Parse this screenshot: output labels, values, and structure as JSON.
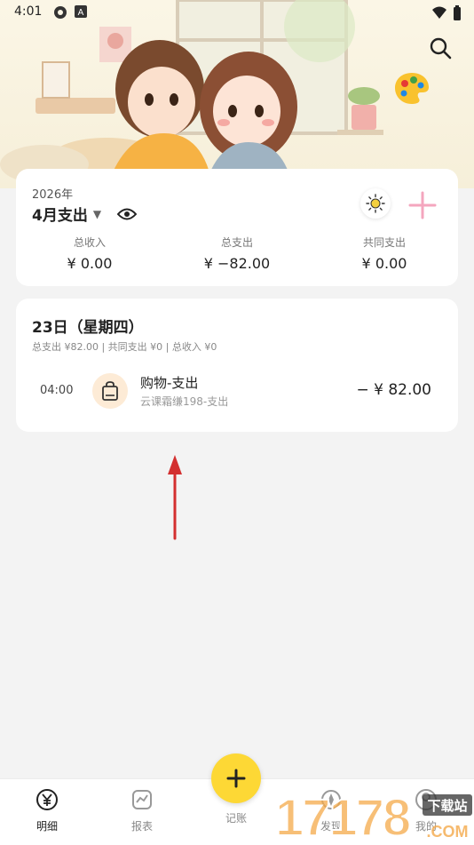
{
  "status_bar": {
    "time": "4:01",
    "left_icons": [
      "sync-icon",
      "a-badge-icon"
    ],
    "right_icons": [
      "wifi-icon",
      "battery-icon"
    ]
  },
  "header": {
    "search_icon": "search-icon",
    "palette_icon": "palette-icon"
  },
  "summary": {
    "year": "2026年",
    "month": "4月支出",
    "caret": "▼",
    "stats": [
      {
        "label": "总收入",
        "value": "¥ 0.00"
      },
      {
        "label": "总支出",
        "value": "¥ −82.00"
      },
      {
        "label": "共同支出",
        "value": "¥ 0.00"
      }
    ],
    "add_color": "#f4a6be",
    "theme_icon": "sun-icon"
  },
  "day": {
    "title": "23日（星期四）",
    "subtitle": "总支出 ¥82.00 | 共同支出 ¥0 | 总收入 ¥0",
    "transactions": [
      {
        "time": "04:00",
        "title": "购物-支出",
        "note": "云课霜缣198-支出",
        "amount": "− ¥ 82.00",
        "icon": "shopping-bag-icon"
      }
    ]
  },
  "nav": {
    "items": [
      {
        "label": "明细",
        "icon": "yen-icon",
        "active": true
      },
      {
        "label": "报表",
        "icon": "chart-icon",
        "active": false
      },
      {
        "label": "记账",
        "icon": "plus-icon",
        "active": false
      },
      {
        "label": "发现",
        "icon": "discover-icon",
        "active": false
      },
      {
        "label": "我的",
        "icon": "profile-icon",
        "active": false
      }
    ]
  },
  "watermark": {
    "text": "17178",
    "sub": "下载站",
    "domain": ".COM"
  },
  "colors": {
    "accent_yellow": "#fdd835",
    "arrow_red": "#d32f2f",
    "pink": "#f4a6be"
  }
}
